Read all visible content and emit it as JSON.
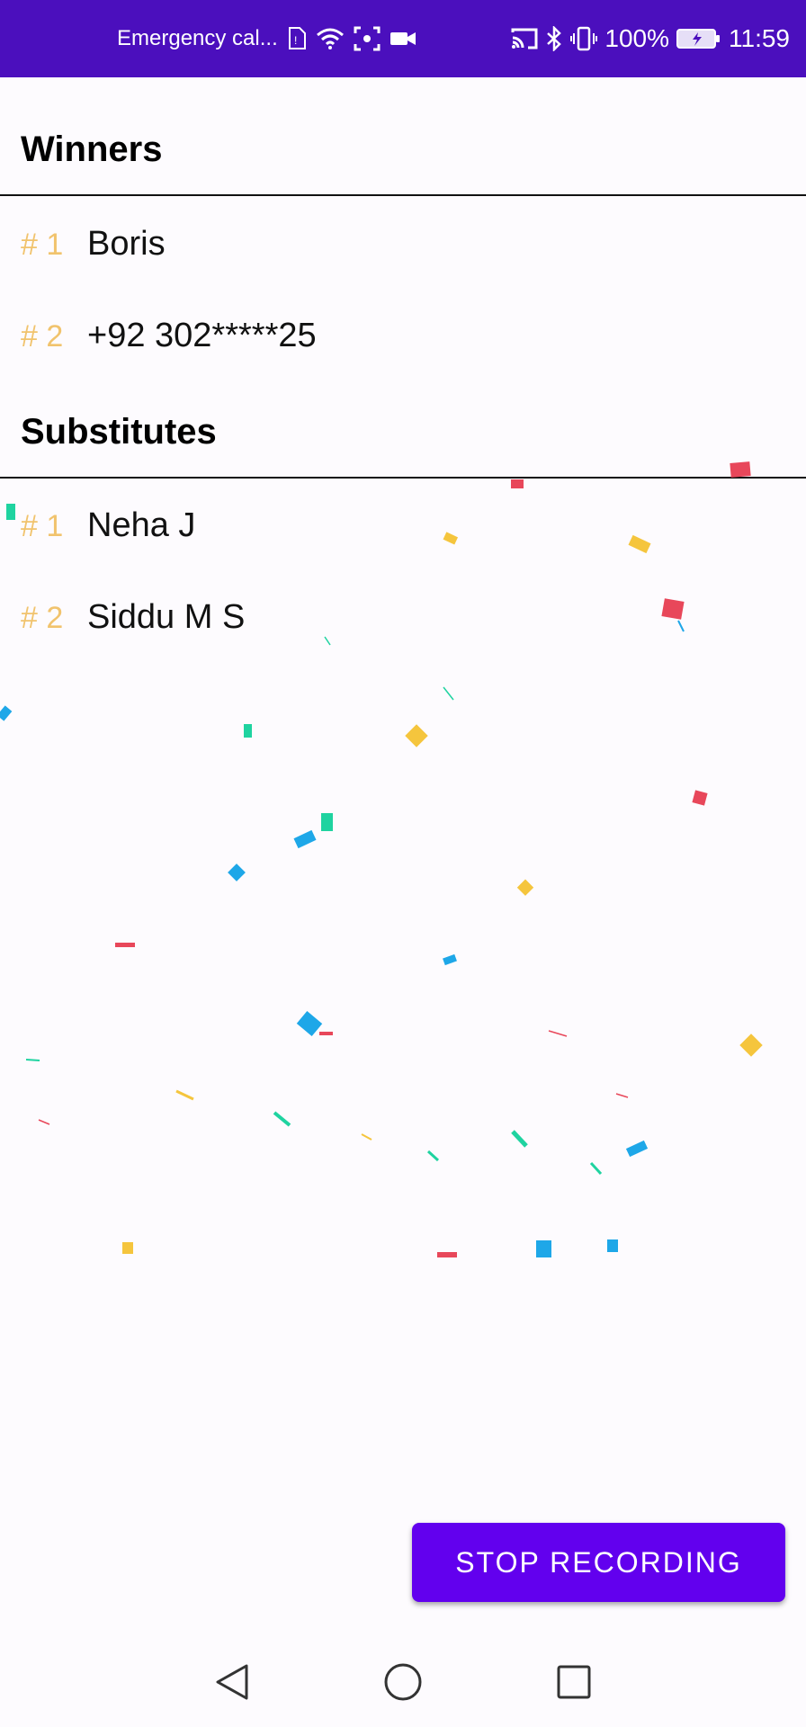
{
  "status_bar": {
    "carrier_text": "Emergency cal...",
    "battery_percent": "100%",
    "time": "11:59",
    "bg_color": "#4b0fbd"
  },
  "winners": {
    "title": "Winners",
    "items": [
      {
        "rank": "# 1",
        "name": "Boris"
      },
      {
        "rank": "# 2",
        "name": "+92 302*****25"
      }
    ]
  },
  "substitutes": {
    "title": "Substitutes",
    "items": [
      {
        "rank": "# 1",
        "name": "Neha J"
      },
      {
        "rank": "# 2",
        "name": "Siddu M S"
      }
    ]
  },
  "actions": {
    "stop_recording_label": "STOP RECORDING",
    "button_color": "#6200ee"
  },
  "colors": {
    "rank_color": "#f1c36d",
    "confetti": [
      "#e8475a",
      "#f5c53d",
      "#1ea7e8",
      "#1fd3a0"
    ]
  },
  "nav": {
    "back_icon": "back-triangle-icon",
    "home_icon": "home-circle-icon",
    "recents_icon": "recents-square-icon"
  }
}
